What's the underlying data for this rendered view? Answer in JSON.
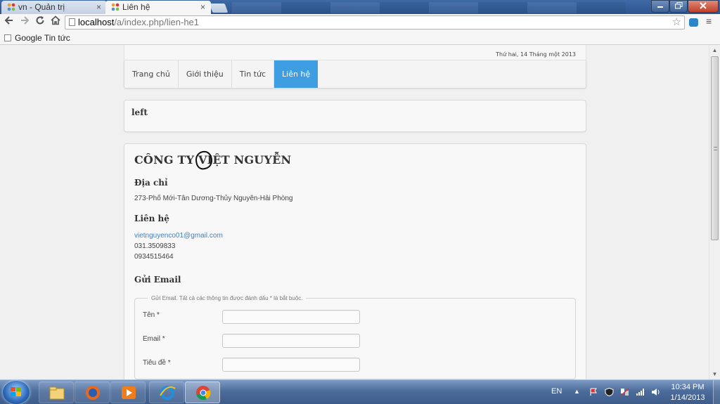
{
  "browser": {
    "tabs": [
      {
        "title": "vn - Quản trị",
        "active": false
      },
      {
        "title": "Liên hệ",
        "active": true
      }
    ],
    "close_glyph": "×",
    "url_host": "localhost",
    "url_path": "/a/index.php/lien-he1",
    "bookmarks": [
      {
        "label": "Google Tin tức"
      }
    ],
    "icons": [
      "back-arrow-icon",
      "forward-arrow-icon",
      "reload-icon",
      "home-icon",
      "bookmark-star-icon",
      "extension-icon",
      "chrome-menu-icon"
    ]
  },
  "site": {
    "date": "Thứ hai, 14 Tháng một 2013",
    "nav": [
      {
        "label": "Trang chủ"
      },
      {
        "label": "Giới thiệu"
      },
      {
        "label": "Tin tức"
      },
      {
        "label": "Liên hệ",
        "active": true
      }
    ],
    "accent_color": "#3f9de1",
    "left_module_title": "left",
    "company": "CÔNG TY VIỆT NGUYỄN",
    "address_heading": "Địa chỉ",
    "address": "273-Phố Mới-Tân Dương-Thủy Nguyên-Hải Phòng",
    "contact_heading": "Liên hệ",
    "contact_email": "vietnguyenco01@gmail.com",
    "contact_phone1": "031.3509833",
    "contact_phone2": "0934515464",
    "send_heading": "Gửi Email",
    "form_legend": "Gửi Email. Tất cả các thông tin được đánh dấu * là bắt buộc.",
    "fields": [
      {
        "label": "Tên *"
      },
      {
        "label": "Email *"
      },
      {
        "label": "Tiêu đề *"
      }
    ]
  },
  "taskbar": {
    "apps": [
      "windows-explorer-icon",
      "firefox-icon",
      "media-player-icon",
      "internet-explorer-icon",
      "chrome-icon"
    ],
    "language": "EN",
    "time": "10:34 PM",
    "date": "1/14/2013"
  }
}
